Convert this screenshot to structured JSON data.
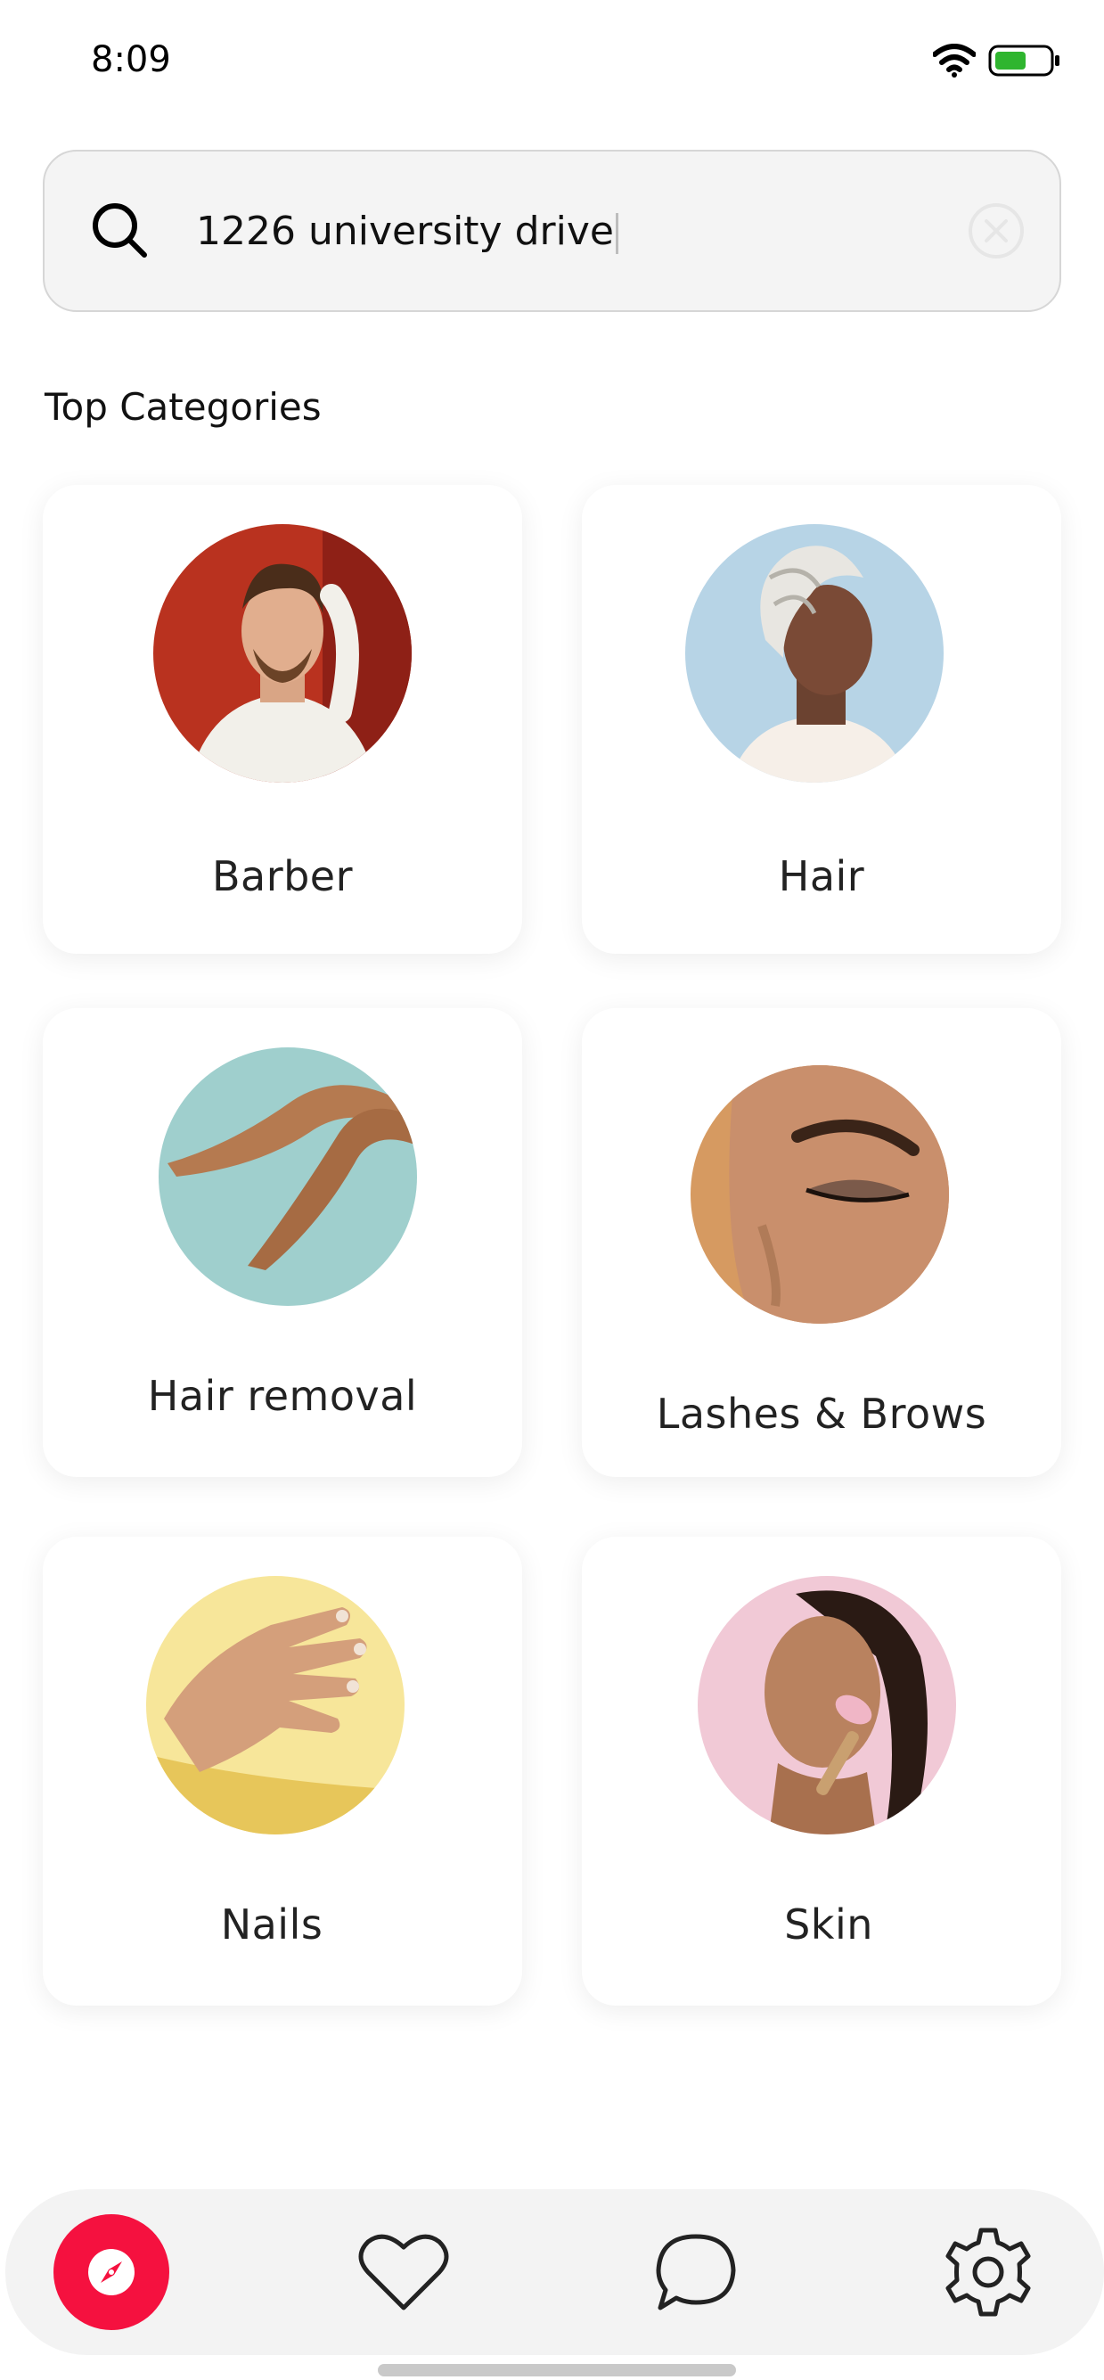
{
  "status_bar": {
    "time": "8:09"
  },
  "search": {
    "value": "1226 university drive"
  },
  "section": {
    "title": "Top Categories"
  },
  "categories": [
    {
      "label": "Barber"
    },
    {
      "label": "Hair"
    },
    {
      "label": "Hair removal"
    },
    {
      "label": "Lashes & Brows"
    },
    {
      "label": "Nails"
    },
    {
      "label": "Skin"
    }
  ],
  "nav": {
    "items": [
      "compass-icon",
      "heart-icon",
      "chat-icon",
      "gear-icon"
    ],
    "active_color": "#f5113f"
  }
}
